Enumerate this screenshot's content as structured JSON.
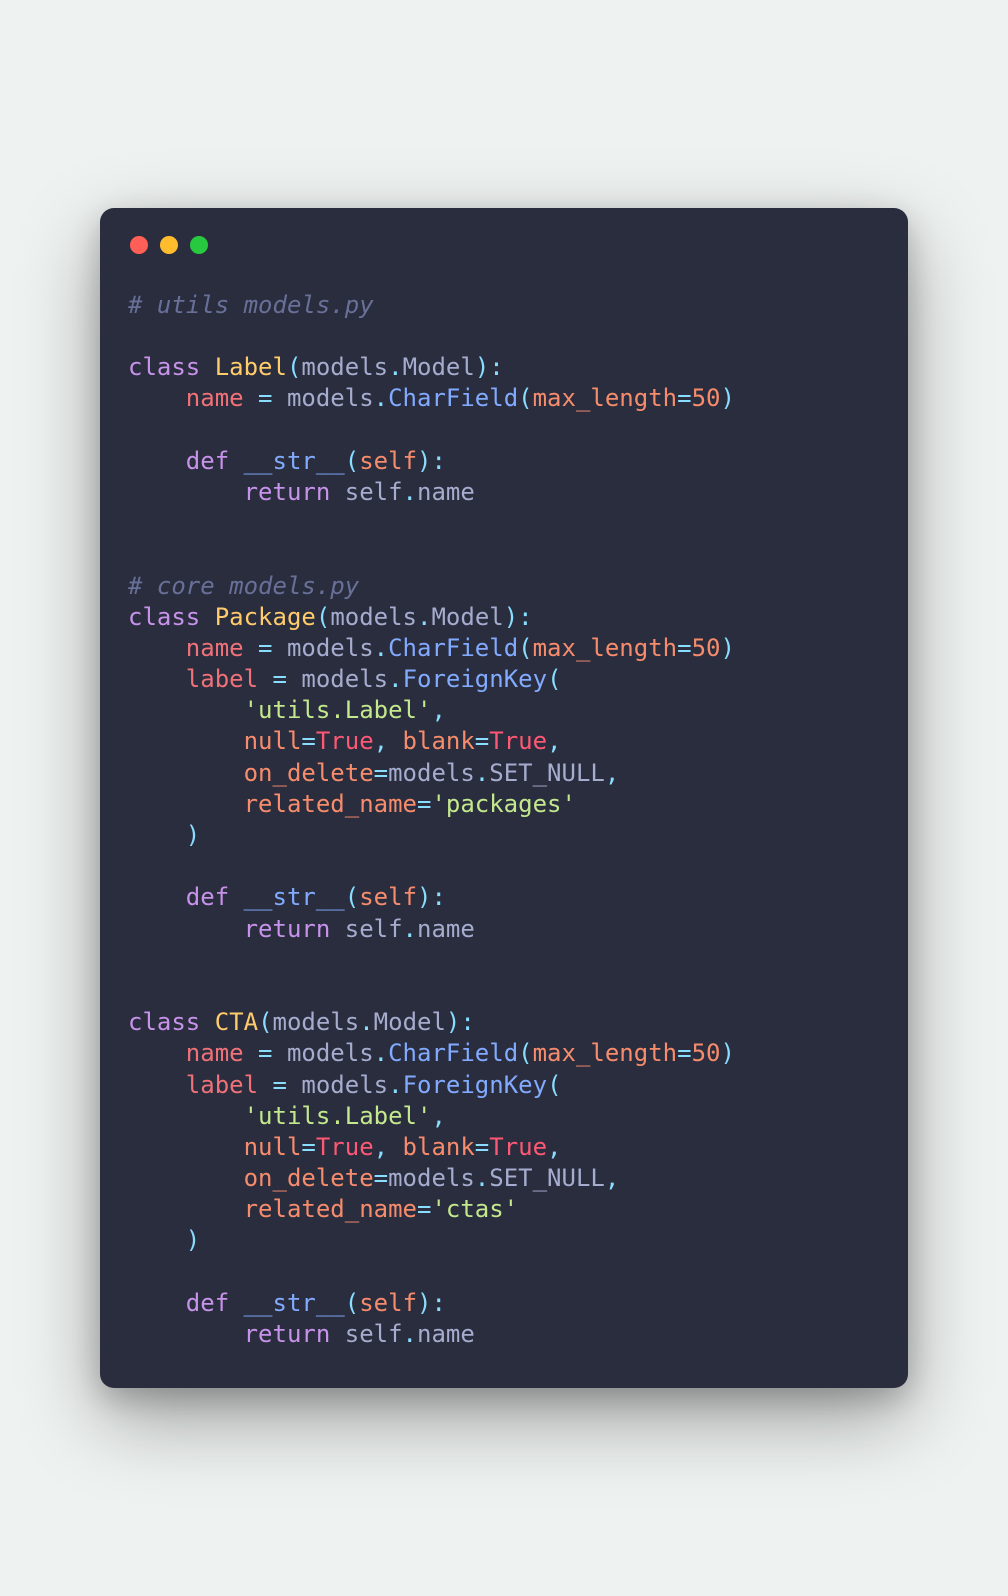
{
  "code": {
    "comment1": "# utils models.py",
    "comment2": "# core models.py",
    "kw_class": "class",
    "kw_def": "def",
    "kw_return": "return",
    "cls_Label": "Label",
    "cls_Package": "Package",
    "cls_CTA": "CTA",
    "id_models": "models",
    "id_Model": "Model",
    "id_CharField": "CharField",
    "id_ForeignKey": "ForeignKey",
    "id_SET_NULL": "SET_NULL",
    "id_name": "name",
    "id_label": "label",
    "id_self": "self",
    "id_str": "__str__",
    "p_max_length": "max_length",
    "p_null": "null",
    "p_blank": "blank",
    "p_on_delete": "on_delete",
    "p_related_name": "related_name",
    "v_True": "True",
    "v_50": "50",
    "s_utils_label": "'utils.Label'",
    "s_packages": "'packages'",
    "s_ctas": "'ctas'"
  }
}
